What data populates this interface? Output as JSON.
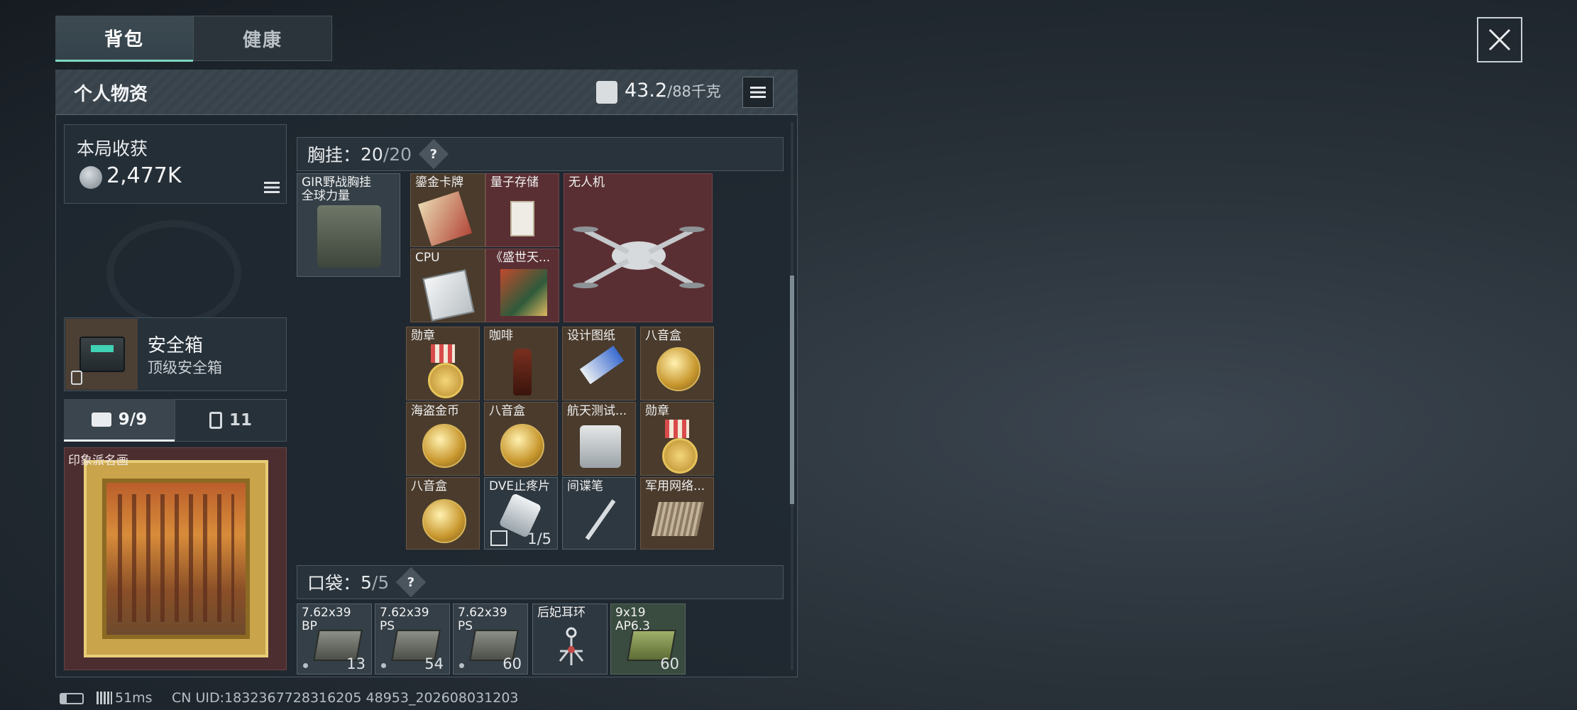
{
  "tabs": {
    "backpack": "背包",
    "health": "健康"
  },
  "panel": {
    "title": "个人物资",
    "weight_current": "43.2",
    "weight_max": "/88千克"
  },
  "gain": {
    "title": "本局收获",
    "value": "2,477K"
  },
  "safe": {
    "name": "安全箱",
    "sub": "顶级安全箱"
  },
  "subtabs": {
    "case_count": "9/9",
    "bag_count": "11"
  },
  "painting": {
    "label": "印象派名画"
  },
  "chest": {
    "label": "胸挂：",
    "count": "20",
    "max": "/20",
    "help": "?",
    "rig_name_1": "GIR野战胸挂",
    "rig_name_2": "全球力量"
  },
  "chest_items": [
    {
      "name": "鎏金卡牌"
    },
    {
      "name": "量子存储"
    },
    {
      "name": "无人机"
    },
    {
      "name": "CPU"
    },
    {
      "name": "《盛世天..."
    },
    {
      "name": "勋章"
    },
    {
      "name": "咖啡"
    },
    {
      "name": "设计图纸"
    },
    {
      "name": "八音盒"
    },
    {
      "name": "海盗金币"
    },
    {
      "name": "八音盒"
    },
    {
      "name": "航天测试..."
    },
    {
      "name": "勋章"
    },
    {
      "name": "八音盒"
    },
    {
      "name": "DVE止疼片",
      "count": "1/5"
    },
    {
      "name": "间谍笔"
    },
    {
      "name": "军用网络..."
    }
  ],
  "pocket": {
    "label": "口袋：",
    "count": "5",
    "max": "/5",
    "help": "?",
    "items": [
      {
        "name": "7.62x39",
        "sub": "BP",
        "count": "13"
      },
      {
        "name": "7.62x39",
        "sub": "PS",
        "count": "54"
      },
      {
        "name": "7.62x39",
        "sub": "PS",
        "count": "60"
      },
      {
        "name": "后妃耳环",
        "sub": "",
        "count": ""
      },
      {
        "name": "9x19",
        "sub": "AP6.3",
        "count": "60"
      }
    ]
  },
  "status": {
    "ping": "51ms",
    "uid": "CN UID:1832367728316205 48953_202608031203"
  }
}
